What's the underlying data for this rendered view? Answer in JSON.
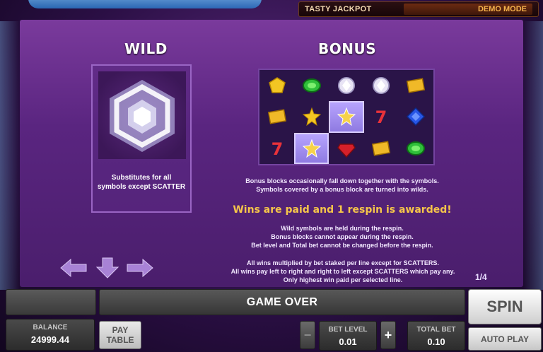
{
  "header": {
    "jackpot_label": "TASTY JACKPOT",
    "mode_label": "DEMO MODE"
  },
  "paytable": {
    "wild": {
      "heading": "WILD",
      "description_line1": "Substitutes for all",
      "description_line2": "symbols except SCATTER"
    },
    "bonus": {
      "heading": "BONUS",
      "grid_symbols": [
        [
          "gold-bar-gem",
          "emerald",
          "diamond",
          "diamond",
          "gold-ticket"
        ],
        [
          "gold-ticket",
          "gold-star-gem",
          "bonus-block",
          "seven",
          "sapphire"
        ],
        [
          "seven",
          "bonus-block",
          "ruby",
          "gold-ticket",
          "emerald"
        ]
      ],
      "desc_line1": "Bonus blocks occasionally fall down together with the symbols.",
      "desc_line2": "Symbols covered by a bonus block are turned into wilds.",
      "wins_title": "Wins are paid and 1 respin is awarded!",
      "respin_line1": "Wild symbols are held during the respin.",
      "respin_line2": "Bonus blocks cannot appear during the respin.",
      "respin_line3": "Bet level and Total bet cannot be changed before the respin.",
      "rule_line1": "All wins multiplied by bet staked per line except for SCATTERS.",
      "rule_line2": "All wins pay left to right and right to left except SCATTERS which pay any.",
      "rule_line3": "Only highest win paid per selected line."
    },
    "page_indicator": "1/4"
  },
  "controls": {
    "status": "GAME OVER",
    "spin_label": "SPIN",
    "balance_label": "BALANCE",
    "balance_value": "24999.44",
    "paytable_line1": "PAY",
    "paytable_line2": "TABLE",
    "minus_label": "−",
    "plus_label": "+",
    "bet_level_label": "BET LEVEL",
    "bet_level_value": "0.01",
    "total_bet_label": "TOTAL BET",
    "total_bet_value": "0.10",
    "autoplay_label": "AUTO PLAY"
  },
  "colors": {
    "wins_title": "#f5c54a",
    "panel": "#5a2580"
  }
}
